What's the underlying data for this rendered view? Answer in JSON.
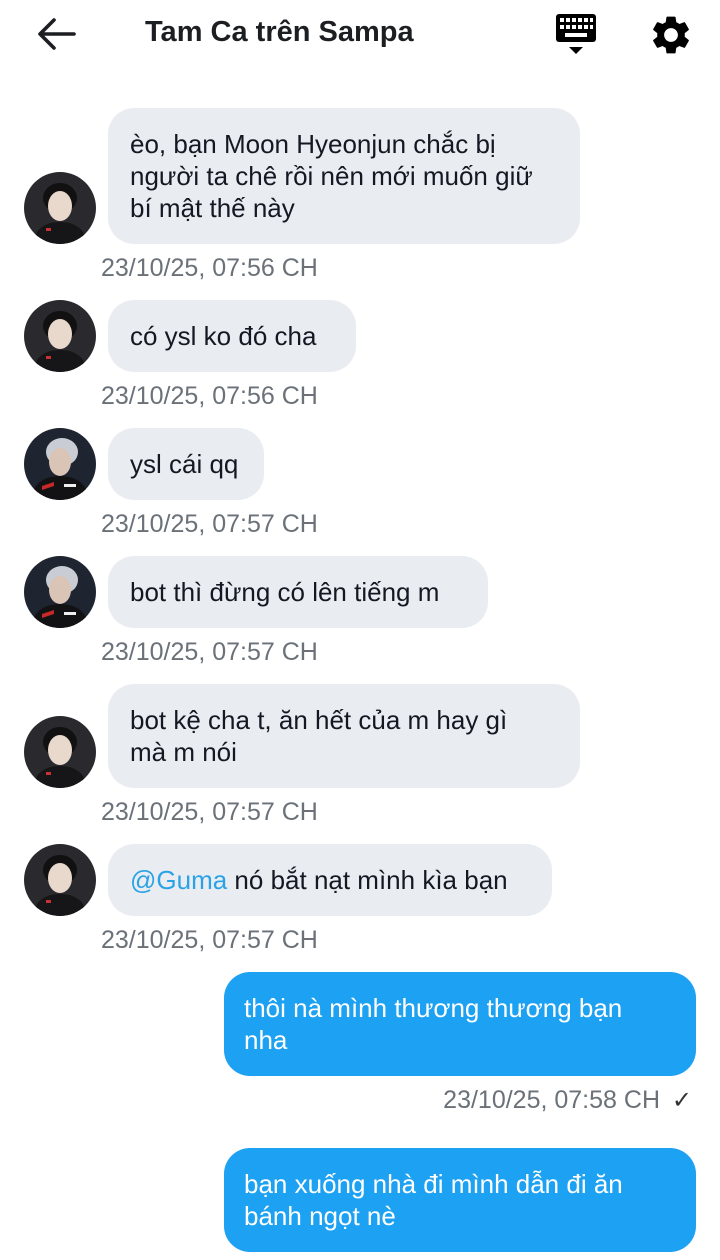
{
  "header": {
    "title": "Tam Ca trên Sampa",
    "back_icon": "arrow-left-icon",
    "keyboard_icon": "keyboard-icon",
    "settings_icon": "gear-icon"
  },
  "colors": {
    "incoming_bubble": "#e9edf1",
    "outgoing_bubble": "#1da1f2",
    "mention": "#2aa3e6",
    "timestamp": "#6a7178"
  },
  "messages": [
    {
      "direction": "incoming",
      "avatar": "avatar-user-a",
      "lines": [
        "èo, bạn Moon Hyeonjun chắc bị",
        "người ta chê rồi nên mới muốn giữ",
        "bí mật thế này"
      ],
      "time": "23/10/25, 07:56 CH"
    },
    {
      "direction": "incoming",
      "avatar": "avatar-user-a",
      "lines": [
        "có ysl ko đó cha"
      ],
      "time": "23/10/25, 07:56 CH"
    },
    {
      "direction": "incoming",
      "avatar": "avatar-user-b",
      "lines": [
        "ysl cái qq"
      ],
      "time": "23/10/25, 07:57 CH"
    },
    {
      "direction": "incoming",
      "avatar": "avatar-user-b",
      "lines": [
        "bot thì đừng có lên tiếng m"
      ],
      "time": "23/10/25, 07:57 CH"
    },
    {
      "direction": "incoming",
      "avatar": "avatar-user-a",
      "lines": [
        "bot kệ cha t, ăn hết của m hay gì",
        "mà m nói"
      ],
      "time": "23/10/25, 07:57 CH"
    },
    {
      "direction": "incoming",
      "avatar": "avatar-user-a",
      "mention": "@Guma",
      "lines": [
        " nó bắt nạt mình kìa bạn"
      ],
      "time": "23/10/25, 07:57 CH"
    },
    {
      "direction": "outgoing",
      "lines": [
        "thôi nà mình thương thương bạn",
        "nha"
      ],
      "time": "23/10/25, 07:58 CH",
      "status": "✓"
    },
    {
      "direction": "outgoing",
      "lines": [
        "bạn xuống nhà đi mình dẫn đi ăn",
        "bánh ngọt nè"
      ]
    }
  ]
}
